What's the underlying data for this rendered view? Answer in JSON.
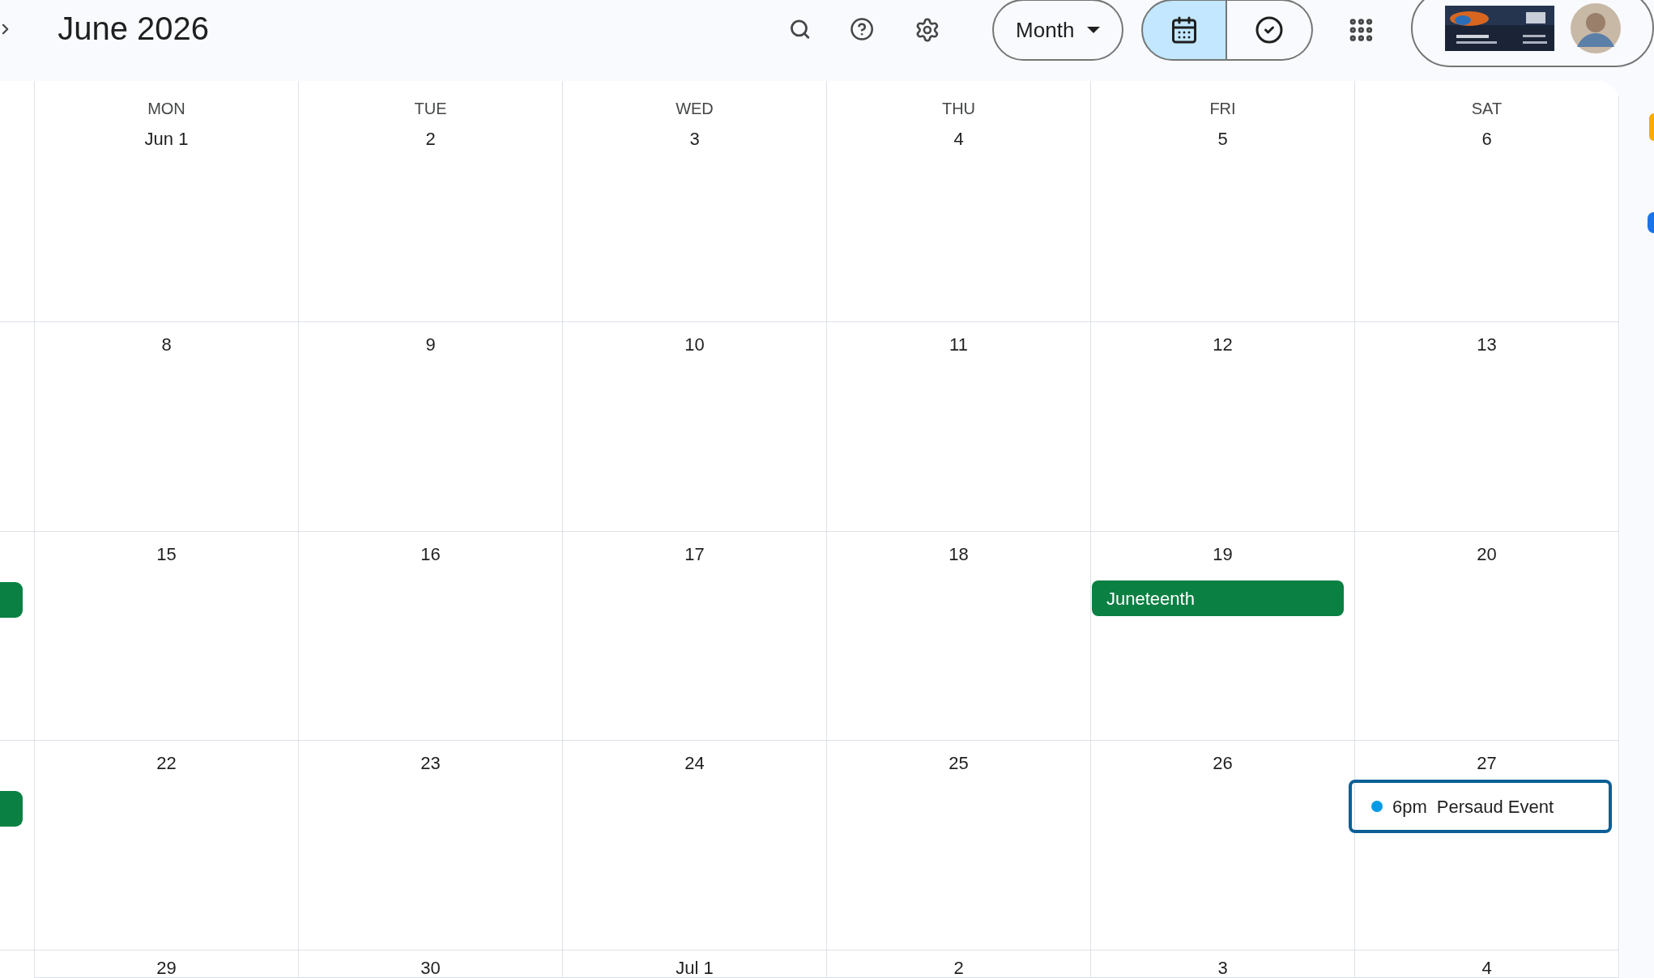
{
  "header": {
    "title": "June 2026",
    "view_menu": {
      "label": "Month"
    },
    "view_toggle": [
      {
        "kind": "calendar",
        "selected": true
      },
      {
        "kind": "tasks",
        "selected": false
      }
    ]
  },
  "calendar": {
    "day_headers": [
      "MON",
      "TUE",
      "WED",
      "THU",
      "FRI",
      "SAT"
    ],
    "weeks": [
      {
        "leading_event": false,
        "days": [
          {
            "date": "Jun 1"
          },
          {
            "date": "2"
          },
          {
            "date": "3"
          },
          {
            "date": "4"
          },
          {
            "date": "5"
          },
          {
            "date": "6"
          }
        ]
      },
      {
        "leading_event": false,
        "days": [
          {
            "date": "8"
          },
          {
            "date": "9"
          },
          {
            "date": "10"
          },
          {
            "date": "11"
          },
          {
            "date": "12"
          },
          {
            "date": "13"
          }
        ]
      },
      {
        "leading_event": true,
        "days": [
          {
            "date": "15"
          },
          {
            "date": "16"
          },
          {
            "date": "17"
          },
          {
            "date": "18"
          },
          {
            "date": "19",
            "events": [
              {
                "kind": "all_day",
                "title": "Juneteenth",
                "color": "#0b8043"
              }
            ]
          },
          {
            "date": "20"
          }
        ]
      },
      {
        "leading_event": true,
        "days": [
          {
            "date": "22"
          },
          {
            "date": "23"
          },
          {
            "date": "24"
          },
          {
            "date": "25"
          },
          {
            "date": "26"
          },
          {
            "date": "27",
            "events": [
              {
                "kind": "timed",
                "time": "6pm",
                "title": "Persaud Event",
                "color": "#039be5",
                "selected": true
              }
            ]
          }
        ]
      },
      {
        "days": [
          {
            "date": "29"
          },
          {
            "date": "30"
          },
          {
            "date": "Jul 1"
          },
          {
            "date": "2"
          },
          {
            "date": "3"
          },
          {
            "date": "4"
          }
        ]
      }
    ]
  }
}
